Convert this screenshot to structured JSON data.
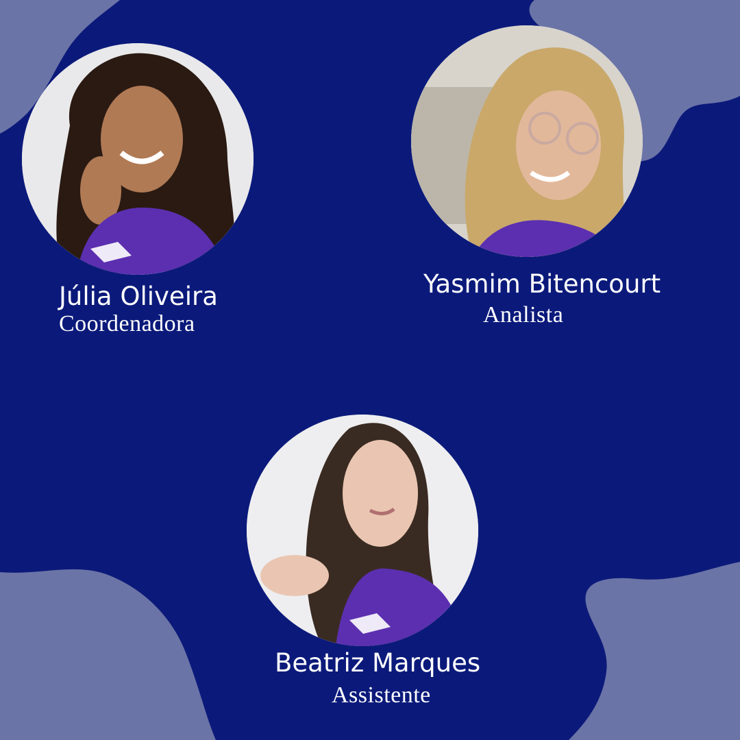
{
  "colors": {
    "background": "#0b1a7a",
    "blob": "#6b74a6",
    "text": "#ffffff",
    "shirt": "#5b2fb0"
  },
  "team": [
    {
      "name": "Júlia Oliveira",
      "role": "Coordenadora",
      "photo": "portrait-julia"
    },
    {
      "name": "Yasmim Bitencourt",
      "role": "Analista",
      "photo": "portrait-yasmim"
    },
    {
      "name": "Beatriz Marques",
      "role": "Assistente",
      "photo": "portrait-beatriz"
    }
  ]
}
